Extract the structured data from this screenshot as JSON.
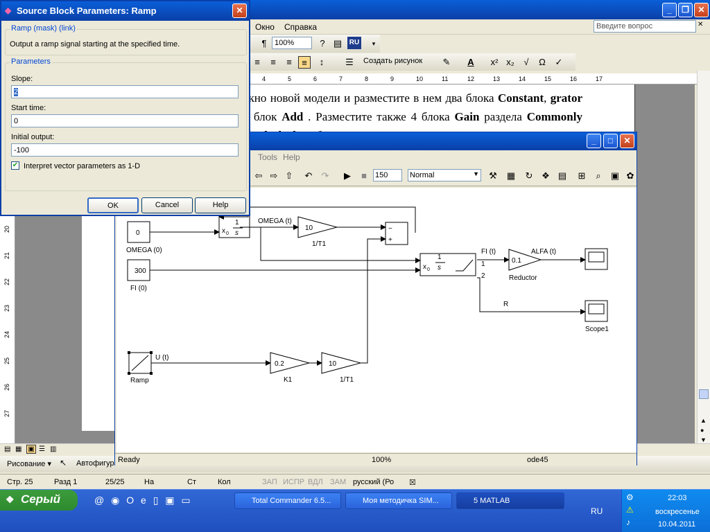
{
  "word": {
    "menu": [
      "Окно",
      "Справка"
    ],
    "ask_placeholder": "Введите вопрос",
    "zoom": "100%",
    "lang_badge": "RU",
    "make_picture": "Создать рисунок",
    "doc_text_html": "окно новой модели и разместите в нем два блока <b>Constant</b>, <b>grator</b> и блок <b>Add</b> . Разместите также 4 блока <b>Gain</b> раздела <b>Commonly Used Blocks</b> и блок <b>Ramps</b> из раздела",
    "ruler_h": [
      "4",
      "5",
      "6",
      "7",
      "8",
      "9",
      "10",
      "11",
      "12",
      "13",
      "14",
      "15",
      "16",
      "17"
    ],
    "ruler_v": [
      "20",
      "21",
      "22",
      "23",
      "24",
      "25",
      "26",
      "27"
    ],
    "status": {
      "page": "Стр. 25",
      "section": "Разд 1",
      "pages": "25/25",
      "at": "На",
      "line": "Ст",
      "col": "Кол",
      "rec": "ЗАП",
      "trk": "ИСПР",
      "ext": "ВДЛ",
      "ovr": "ЗАМ",
      "lang": "русский (Ро"
    },
    "draw_label": "Рисование",
    "autoshapes": "Автофигуры"
  },
  "taskbar": {
    "start": "Серый",
    "tasks": [
      "Total Commander 6.5...",
      "Моя методичка SIM...",
      "5 MATLAB"
    ],
    "lang": "RU",
    "time": "22:03",
    "day": "воскресенье",
    "date": "10.04.2011"
  },
  "simulink": {
    "menu": [
      "Tools",
      "Help"
    ],
    "stop_time": "150",
    "sim_mode": "Normal",
    "status": {
      "ready": "Ready",
      "zoom": "100%",
      "solver": "ode45"
    },
    "blocks": {
      "const1_value": "0",
      "const1_label": "OMEGA (0)",
      "const2_value": "300",
      "const2_label": "FI (0)",
      "int_frac": "1",
      "int_den": "s",
      "int_x0": "x",
      "int_sub": "0",
      "omega_label": "OMEGA (t)",
      "gain1_value": "10",
      "gain1_label": "1/T1",
      "sum_minus": "−",
      "sum_plus": "+",
      "fi_label": "FI (t)",
      "port1": "1",
      "port2": "2",
      "gain_red_value": "0.1",
      "gain_red_label": "Reductor",
      "alfa_label": "ALFA (t)",
      "r_label": "R",
      "scope1_label": "Scope1",
      "ramp_label": "Ramp",
      "u_label": "U (t)",
      "k1_value": "0.2",
      "k1_label": "K1",
      "gain3_value": "10",
      "gain3_label": "1/T1"
    }
  },
  "dialog": {
    "title": "Source Block Parameters: Ramp",
    "mask_group": "Ramp (mask) (link)",
    "description": "Output a ramp signal starting at the specified time.",
    "params_group": "Parameters",
    "slope_label": "Slope:",
    "slope_value": "2",
    "start_label": "Start time:",
    "start_value": "0",
    "init_label": "Initial output:",
    "init_value": "-100",
    "checkbox_label": "Interpret vector parameters as 1-D",
    "ok": "OK",
    "cancel": "Cancel",
    "help": "Help"
  }
}
